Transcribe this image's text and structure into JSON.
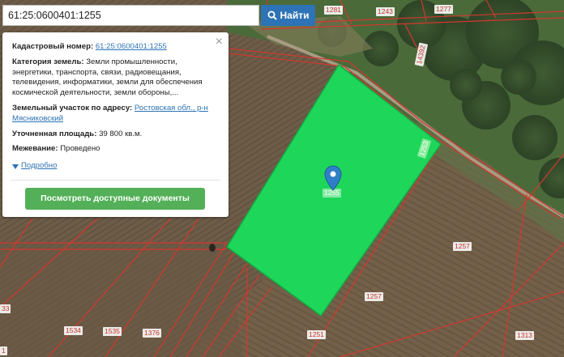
{
  "search": {
    "value": "61:25:0600401:1255",
    "button_label": "Найти"
  },
  "info": {
    "cadastral_label": "Кадастровый номер:",
    "cadastral_number": "61:25:0600401:1255",
    "category_label": "Категория земель:",
    "category_value": "Земли промышленности, энергетики, транспорта, связи, радиовещания, телевидения, информатики, земли для обеспечения космической деятельности, земли обороны,...",
    "address_label": "Земельный участок по адресу:",
    "address_value": "Ростовская обл., р-н Мясниковский",
    "area_label": "Уточненная площадь:",
    "area_value": "39 800 кв.м.",
    "survey_label": "Межевание:",
    "survey_value": "Проведено",
    "more_label": "Подробно",
    "docs_button": "Посмотреть доступные документы",
    "close": "×"
  },
  "parcel_labels": {
    "p1281": "1281",
    "p1243": "1243",
    "p1277": "1277",
    "p14392": "14392",
    "p1253": "1253",
    "p1255": "1255",
    "p1257a": "1257",
    "p1257b": "1257",
    "p1251": "1251",
    "p1313": "1313",
    "p1534": "1534",
    "p1535": "1535",
    "p1376": "1376",
    "p33": "33",
    "p1": "1"
  },
  "colors": {
    "highlight": "#1ed65a",
    "boundary": "#d2382f",
    "button": "#2d73b5",
    "docs_button": "#54b058"
  }
}
